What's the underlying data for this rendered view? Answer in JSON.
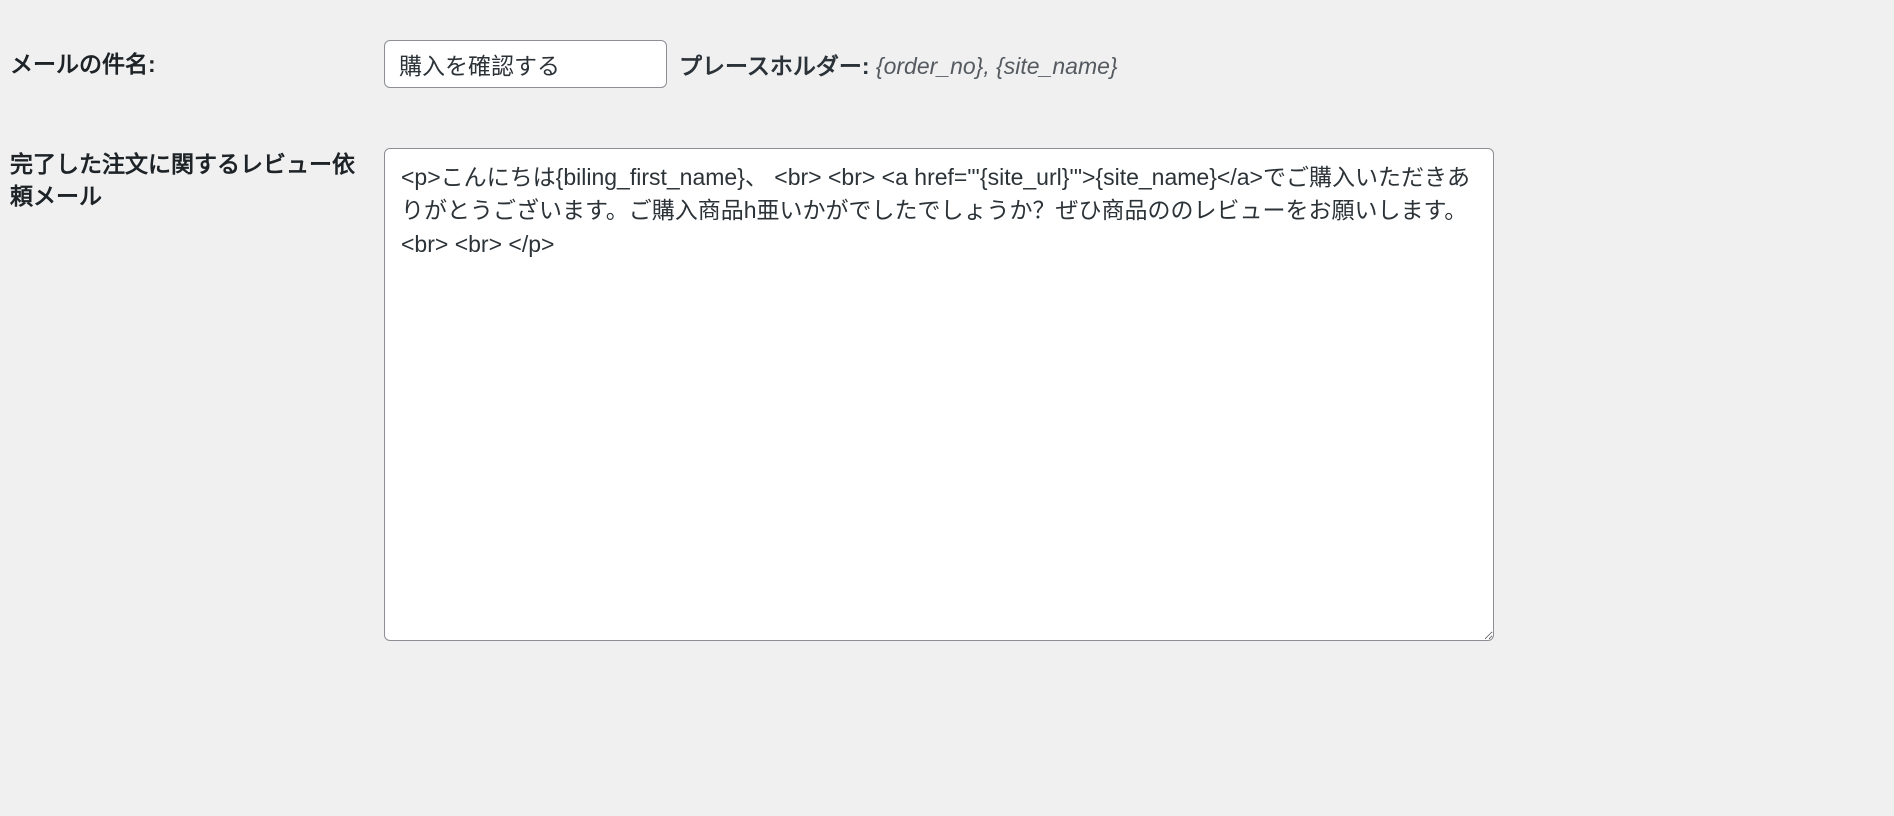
{
  "email_subject": {
    "label": "メールの件名:",
    "value": "購入を確認する",
    "placeholder_label": "プレースホルダー:",
    "placeholder_values": "{order_no}, {site_name}"
  },
  "review_request_email": {
    "label": "完了した注文に関するレビュー依頼メール",
    "value": "<p>こんにちは{biling_first_name}、 <br> <br> <a href=\"'{site_url}'\">{site_name}</a>でご購入いただきありがとうございます。ご購入商品h亜いかがでしたでしょうか？ぜひ商品ののレビューをお願いします。<br> <br> </p>"
  }
}
